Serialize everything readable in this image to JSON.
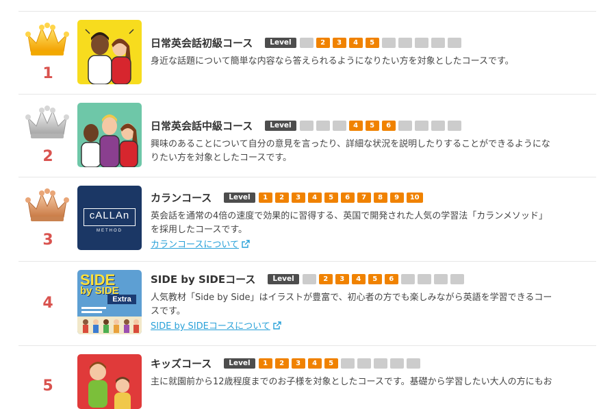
{
  "colors": {
    "rank": "#d9534f",
    "level_active": "#f08200",
    "level_inactive": "#cccccc",
    "level_tag": "#4d4d4d",
    "link": "#27a0d8"
  },
  "level_tag_label": "Level",
  "courses": [
    {
      "rank": "1",
      "crown": "gold-crown-icon",
      "title": "日常英会話初級コース",
      "levels": [
        "",
        "2",
        "3",
        "4",
        "5",
        "",
        "",
        "",
        "",
        ""
      ],
      "description": "身近な話題について簡単な内容なら答えられるようになりたい方を対象としたコースです。"
    },
    {
      "rank": "2",
      "crown": "silver-crown-icon",
      "title": "日常英会話中級コース",
      "levels": [
        "",
        "",
        "",
        "4",
        "5",
        "6",
        "",
        "",
        "",
        ""
      ],
      "description_lines": [
        "興味のあることについて自分の意見を言ったり、詳細な状況を説明したりすることができるようにな",
        "りたい方を対象としたコースです。"
      ]
    },
    {
      "rank": "3",
      "crown": "bronze-crown-icon",
      "title": "カランコース",
      "levels": [
        "1",
        "2",
        "3",
        "4",
        "5",
        "6",
        "7",
        "8",
        "9",
        "10"
      ],
      "description_lines": [
        "英会話を通常の4倍の速度で効果的に習得する、英国で開発された人気の学習法「カランメソッド」",
        "を採用したコースです。"
      ],
      "link": "カランコースについて",
      "logo": {
        "line1": "cALLAn",
        "line2": "METHOD"
      }
    },
    {
      "rank": "4",
      "title": "SIDE by SIDEコース",
      "levels": [
        "",
        "2",
        "3",
        "4",
        "5",
        "6",
        "",
        "",
        "",
        ""
      ],
      "description_lines": [
        "人気教材「Side by Side」はイラストが豊富で、初心者の方でも楽しみながら英語を学習できるコー",
        "スです。"
      ],
      "link": "SIDE by SIDEコースについて",
      "book": {
        "line1": "SIDE",
        "line2": "by SIDE",
        "line3": "Extra"
      }
    },
    {
      "rank": "5",
      "title": "キッズコース",
      "levels": [
        "1",
        "2",
        "3",
        "4",
        "5",
        "",
        "",
        "",
        "",
        ""
      ],
      "description": "主に就園前から12歳程度までのお子様を対象としたコースです。基礎から学習したい大人の方にもお"
    }
  ]
}
